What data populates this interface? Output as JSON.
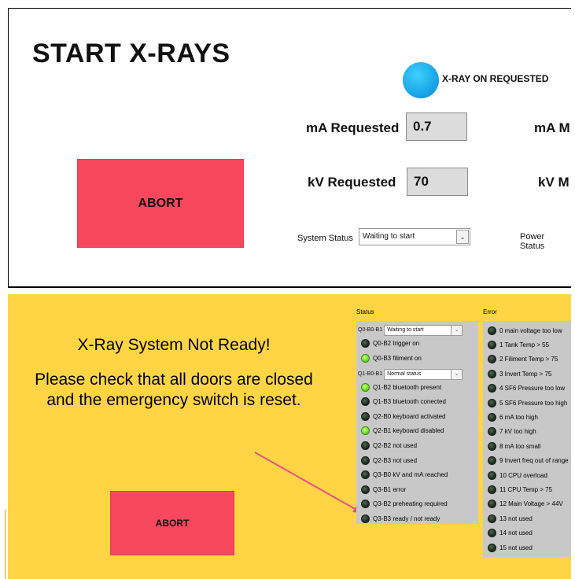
{
  "top": {
    "title": "START X-RAYS",
    "xray_on_requested_label": "X-RAY ON REQUESTED",
    "ma_requested_label": "mA Requested",
    "ma_requested_value": "0.7",
    "ma_measured_label": "mA M",
    "kv_requested_label": "kV Requested",
    "kv_requested_value": "70",
    "kv_measured_label": "kV M",
    "abort_label": "ABORT",
    "system_status_label": "System Status",
    "system_status_value": "Waiting to start",
    "power_status_label": "Power Status",
    "colors": {
      "abort": "#f8485e",
      "indicator": "#1aa6e8"
    }
  },
  "bottom": {
    "message_line1": "X-Ray System Not Ready!",
    "message_line2": "Please check that all doors are closed and the emergency switch is reset.",
    "abort_label": "ABORT",
    "status_title": "Status",
    "error_title": "Error",
    "status_combo1_label": "Q0-B0-B1",
    "status_combo1_value": "Waiting to start",
    "status_combo2_label": "Q1-B0-B1",
    "status_combo2_value": "Normal status",
    "status_items": [
      {
        "label": "Q0-B2 trigger on",
        "on": false
      },
      {
        "label": "Q0-B3 filiment on",
        "on": true
      },
      {
        "label": "Q1-B2 bluetooth present",
        "on": true
      },
      {
        "label": "Q1-B3 bluetooth conected",
        "on": false
      },
      {
        "label": "Q2-B0 keyboard activated",
        "on": false
      },
      {
        "label": "Q2-B1 keyboard disabled",
        "on": true
      },
      {
        "label": "Q2-B2 not used",
        "on": false
      },
      {
        "label": "Q2-B3 not used",
        "on": false
      },
      {
        "label": "Q3-B0 kV and mA reached",
        "on": false
      },
      {
        "label": "Q3-B1 error",
        "on": false
      },
      {
        "label": "Q3-B2 preheating required",
        "on": false
      },
      {
        "label": "Q3-B3 ready / not ready",
        "on": false
      }
    ],
    "error_items": [
      {
        "label": "0 main voltage too low",
        "on": false
      },
      {
        "label": "1 Tank Temp > 55",
        "on": false
      },
      {
        "label": "2 Filiment Temp > 75",
        "on": false
      },
      {
        "label": "3 Invert Temp > 75",
        "on": false
      },
      {
        "label": "4 SF6 Pressure too low",
        "on": false
      },
      {
        "label": "5 SF6 Pressure too high",
        "on": false
      },
      {
        "label": "6 mA too high",
        "on": false
      },
      {
        "label": "7 kV too high",
        "on": false
      },
      {
        "label": "8 mA too small",
        "on": false
      },
      {
        "label": "9 Invert freq out of range",
        "on": false
      },
      {
        "label": "10 CPU overload",
        "on": false
      },
      {
        "label": "11 CPU Temp > 75",
        "on": false
      },
      {
        "label": "12 Main Voltage > 44V",
        "on": false
      },
      {
        "label": "13 not used",
        "on": false
      },
      {
        "label": "14 not used",
        "on": false
      },
      {
        "label": "15 not used",
        "on": false
      }
    ],
    "colors": {
      "background": "#ffd545",
      "led_on": "#6fe12a",
      "led_off": "#203020",
      "arrow": "#e8508a"
    }
  }
}
